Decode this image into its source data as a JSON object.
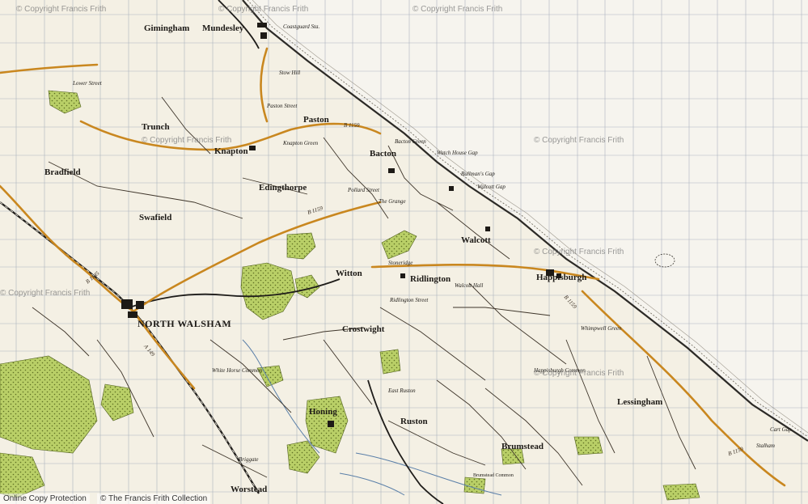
{
  "map": {
    "places": [
      {
        "id": "gimingham",
        "name": "Gimingham",
        "cls": "town"
      },
      {
        "id": "mundesley",
        "name": "Mundesley",
        "cls": "town"
      },
      {
        "id": "paston",
        "name": "Paston",
        "cls": "town"
      },
      {
        "id": "trunch",
        "name": "Trunch",
        "cls": "town"
      },
      {
        "id": "knapton",
        "name": "Knapton",
        "cls": "town"
      },
      {
        "id": "bacton",
        "name": "Bacton",
        "cls": "town"
      },
      {
        "id": "bradfield",
        "name": "Bradfield",
        "cls": "town"
      },
      {
        "id": "edingthorpe",
        "name": "Edingthorpe",
        "cls": "town"
      },
      {
        "id": "swafield",
        "name": "Swafield",
        "cls": "town"
      },
      {
        "id": "witton",
        "name": "Witton",
        "cls": "town"
      },
      {
        "id": "ridlington",
        "name": "Ridlington",
        "cls": "town"
      },
      {
        "id": "walcott",
        "name": "Walcott",
        "cls": "town"
      },
      {
        "id": "happisburgh",
        "name": "Happisburgh",
        "cls": "town"
      },
      {
        "id": "north-walsham",
        "name": "NORTH WALSHAM",
        "cls": "town-lg"
      },
      {
        "id": "crostwight",
        "name": "Crostwight",
        "cls": "town"
      },
      {
        "id": "honing",
        "name": "Honing",
        "cls": "town"
      },
      {
        "id": "ruston",
        "name": "Ruston",
        "cls": "town"
      },
      {
        "id": "brumstead",
        "name": "Brumstead",
        "cls": "town"
      },
      {
        "id": "lessingham",
        "name": "Lessingham",
        "cls": "town"
      },
      {
        "id": "worstead",
        "name": "Worstead",
        "cls": "town"
      },
      {
        "id": "bacton-green",
        "name": "Bacton Green",
        "cls": "small"
      },
      {
        "id": "stow-hill",
        "name": "Stow Hill",
        "cls": "small"
      },
      {
        "id": "paston-street",
        "name": "Paston Street",
        "cls": "small"
      },
      {
        "id": "lower-street",
        "name": "Lower Street",
        "cls": "small"
      },
      {
        "id": "knapton-green",
        "name": "Knapton Green",
        "cls": "small"
      },
      {
        "id": "the-grange",
        "name": "The Grange",
        "cls": "small"
      },
      {
        "id": "pollard-street",
        "name": "Pollard Street",
        "cls": "small"
      },
      {
        "id": "watch-house-gap",
        "name": "Watch House Gap",
        "cls": "small"
      },
      {
        "id": "bullmans-gap",
        "name": "Bullman's Gap",
        "cls": "small"
      },
      {
        "id": "walcott-gap",
        "name": "Walcott Gap",
        "cls": "small"
      },
      {
        "id": "stoneridge",
        "name": "Stoneridge",
        "cls": "small"
      },
      {
        "id": "ridlington-street",
        "name": "Ridlington Street",
        "cls": "small"
      },
      {
        "id": "walcott-hall",
        "name": "Walcott Hall",
        "cls": "small"
      },
      {
        "id": "happisburgh-common",
        "name": "Happisburgh Common",
        "cls": "small"
      },
      {
        "id": "east-ruston",
        "name": "East Ruston",
        "cls": "small"
      },
      {
        "id": "briggate",
        "name": "Briggate",
        "cls": "small"
      },
      {
        "id": "white-horse-common",
        "name": "White Horse Common",
        "cls": "small"
      },
      {
        "id": "cart-gap",
        "name": "Cart Gap",
        "cls": "small"
      },
      {
        "id": "stalham",
        "name": "Stalham",
        "cls": "small"
      },
      {
        "id": "coastguard-sta",
        "name": "Coastguard Sta.",
        "cls": "small"
      },
      {
        "id": "brumstead-common",
        "name": "Brumstead Common",
        "cls": "mini"
      },
      {
        "id": "whimpwell-green",
        "name": "Whimpwell Green",
        "cls": "small"
      }
    ],
    "roads": [
      {
        "id": "b1145-west",
        "label": "B 1145"
      },
      {
        "id": "b1150-paston",
        "label": "B 1159"
      },
      {
        "id": "b1159-edingthorpe",
        "label": "B 1159"
      },
      {
        "id": "a149",
        "label": "A 149"
      },
      {
        "id": "b1159-coast",
        "label": "B 1159"
      },
      {
        "id": "b1159-south",
        "label": "B 1159"
      }
    ],
    "watermarks": [
      {
        "id": "wm-1",
        "text": "© Copyright Francis Frith"
      },
      {
        "id": "wm-2",
        "text": "© Copyright Francis Frith"
      },
      {
        "id": "wm-3",
        "text": "© Copyright Francis Frith"
      },
      {
        "id": "wm-4",
        "text": "© Copyright Francis Frith"
      },
      {
        "id": "wm-5",
        "text": "© Copyright Francis Frith"
      },
      {
        "id": "wm-6",
        "text": "© Copyright Francis Frith"
      },
      {
        "id": "wm-7",
        "text": "© Copyright Francis Frith"
      },
      {
        "id": "wm-8",
        "text": "© Copyright Francis Frith"
      }
    ],
    "footer": {
      "left": "Online Copy Protection",
      "right": "© The Francis Frith Collection"
    }
  }
}
